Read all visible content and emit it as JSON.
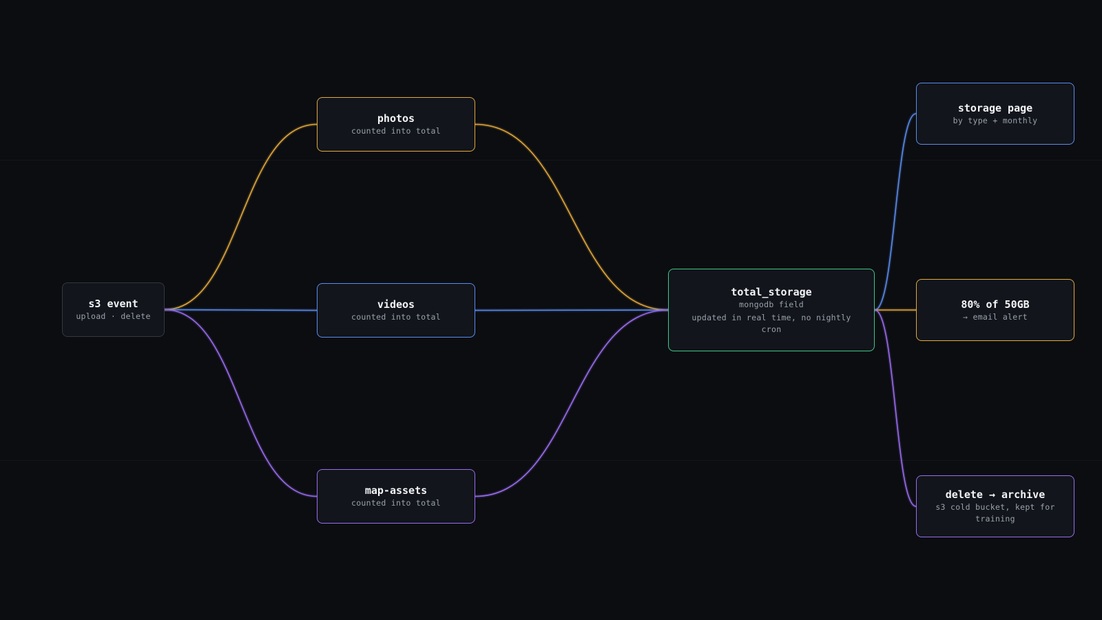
{
  "colors": {
    "orange": "#e2a93b",
    "blue": "#5a8dee",
    "purple": "#9a6cf0",
    "green": "#3fc784",
    "gray": "#343841"
  },
  "nodes": {
    "s3_event": {
      "title": "s3 event",
      "subtitle": "upload · delete"
    },
    "photos": {
      "title": "photos",
      "subtitle": "counted into total"
    },
    "videos": {
      "title": "videos",
      "subtitle": "counted into total"
    },
    "map_assets": {
      "title": "map-assets",
      "subtitle": "counted into total"
    },
    "total_storage": {
      "title": "total_storage",
      "subtitle": "mongodb field",
      "note": "updated in real time, no nightly cron"
    },
    "storage_page": {
      "title": "storage page",
      "subtitle": "by type + monthly"
    },
    "alert": {
      "title": "80% of 50GB",
      "subtitle": "→ email alert"
    },
    "archive": {
      "title": "delete → archive",
      "subtitle": "s3 cold bucket, kept for training"
    }
  },
  "edges": [
    {
      "from": "s3_event",
      "to": "photos",
      "color": "orange"
    },
    {
      "from": "s3_event",
      "to": "videos",
      "color": "blue"
    },
    {
      "from": "s3_event",
      "to": "map_assets",
      "color": "purple"
    },
    {
      "from": "photos",
      "to": "total_storage",
      "color": "orange"
    },
    {
      "from": "videos",
      "to": "total_storage",
      "color": "blue"
    },
    {
      "from": "map_assets",
      "to": "total_storage",
      "color": "purple"
    },
    {
      "from": "total_storage",
      "to": "storage_page",
      "color": "blue"
    },
    {
      "from": "total_storage",
      "to": "alert",
      "color": "orange"
    },
    {
      "from": "total_storage",
      "to": "archive",
      "color": "purple"
    }
  ]
}
